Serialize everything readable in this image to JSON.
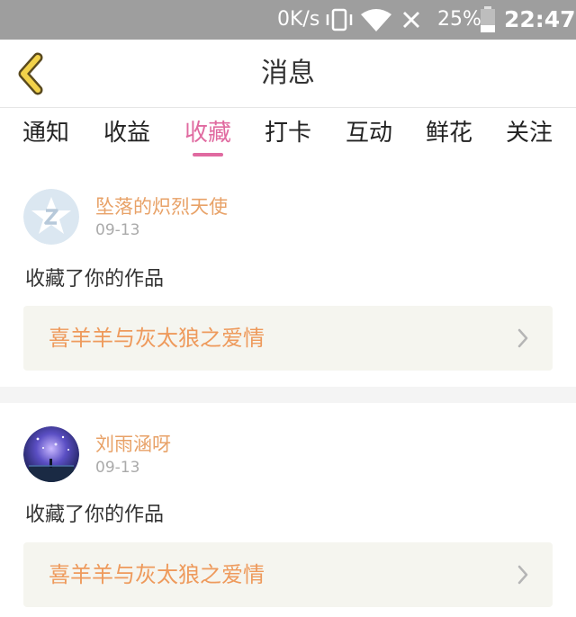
{
  "status_bar": {
    "network_speed": "0K/s",
    "battery_percent": "25%",
    "time": "22:47"
  },
  "header": {
    "title": "消息"
  },
  "tabs": [
    {
      "label": "通知",
      "active": false
    },
    {
      "label": "收益",
      "active": false
    },
    {
      "label": "收藏",
      "active": true
    },
    {
      "label": "打卡",
      "active": false
    },
    {
      "label": "互动",
      "active": false
    },
    {
      "label": "鲜花",
      "active": false
    },
    {
      "label": "关注",
      "active": false
    }
  ],
  "messages": [
    {
      "username": "坠落的炽烈天使",
      "date": "09-13",
      "action": "收藏了你的作品",
      "work_title": "喜羊羊与灰太狼之爱情"
    },
    {
      "username": "刘雨涵呀",
      "date": "09-13",
      "action": "收藏了你的作品",
      "work_title": "喜羊羊与灰太狼之爱情"
    }
  ],
  "colors": {
    "accent_pink": "#e06aa0",
    "username_orange": "#e8a268",
    "work_title_orange": "#ee9a5c",
    "back_yellow": "#f2d24a"
  }
}
